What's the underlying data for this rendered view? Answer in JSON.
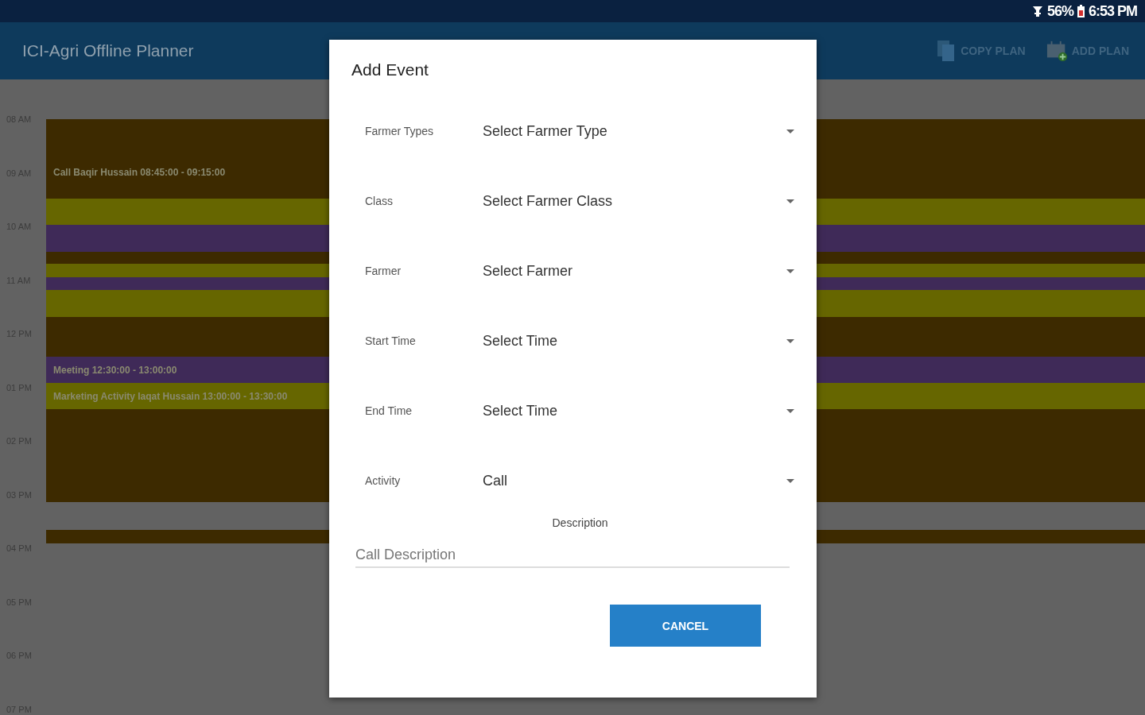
{
  "status_bar": {
    "battery": "56%",
    "time": "6:53 PM"
  },
  "app_bar": {
    "title": "ICI-Agri Offline Planner",
    "actions": [
      {
        "label": "COPY PLAN",
        "kind": "copy"
      },
      {
        "label": "ADD PLAN",
        "kind": "add"
      }
    ]
  },
  "timeline": {
    "hours": [
      "08 AM",
      "09 AM",
      "10 AM",
      "11 AM",
      "12 PM",
      "01 PM",
      "02 PM",
      "03 PM",
      "04 PM",
      "05 PM",
      "06 PM",
      "07 PM"
    ],
    "events": [
      {
        "kind": "event",
        "color": "#3d2a00",
        "label": "Call Baqir  Hussain 08:45:00 - 09:15:00"
      },
      {
        "kind": "event",
        "color": "#666600"
      },
      {
        "kind": "event",
        "color": "#3f2a58"
      },
      {
        "kind": "event",
        "color": "#3d2a00"
      },
      {
        "kind": "event",
        "color": "#666600"
      },
      {
        "kind": "event",
        "color": "#3f2a58"
      },
      {
        "kind": "event",
        "color": "#666600"
      },
      {
        "kind": "event",
        "color": "#3d2a00"
      },
      {
        "kind": "event",
        "color": "#3f2a58",
        "label": "Meeting  12:30:00 - 13:00:00"
      },
      {
        "kind": "event",
        "color": "#666600",
        "label": "Marketing Activity Iaqat  Hussain 13:00:00 - 13:30:00"
      },
      {
        "kind": "event",
        "color": "#3d2a00"
      },
      {
        "kind": "gap"
      },
      {
        "kind": "event",
        "color": "#3d2a00"
      }
    ]
  },
  "dialog": {
    "title": "Add Event",
    "fields": [
      {
        "label": "Farmer Types",
        "value": "Select Farmer Type"
      },
      {
        "label": "Class",
        "value": "Select Farmer Class"
      },
      {
        "label": "Farmer",
        "value": "Select Farmer"
      },
      {
        "label": "Start Time",
        "value": "Select Time"
      },
      {
        "label": "End Time",
        "value": "Select Time"
      },
      {
        "label": "Activity",
        "value": "Call"
      }
    ],
    "description": {
      "label": "Description",
      "placeholder": "Call Description"
    },
    "buttons": [
      "CANCEL"
    ]
  }
}
